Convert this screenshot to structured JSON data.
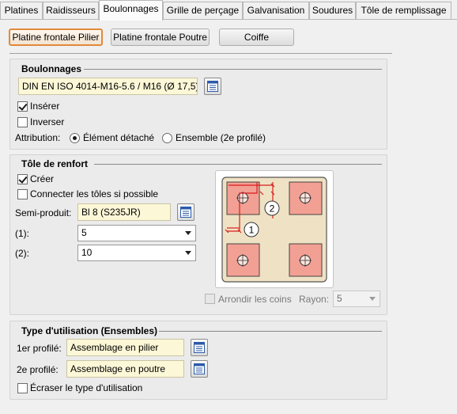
{
  "tabs": [
    "Platines",
    "Raidisseurs",
    "Boulonnages",
    "Grille de perçage",
    "Galvanisation",
    "Soudures",
    "Tôle de remplissage"
  ],
  "active_tab": "Boulonnages",
  "top_buttons": [
    "Platine frontale Pilier",
    "Platine frontale Poutre",
    "Coiffe"
  ],
  "bolting": {
    "title": "Boulonnages",
    "bolt_value": "DIN EN ISO 4014-M16-5.6 / M16 (Ø 17,5)",
    "insert_label": "Insérer",
    "insert_checked": true,
    "invert_label": "Inverser",
    "invert_checked": false,
    "attribution_label": "Attribution:",
    "attribution_options": [
      "Élément détaché",
      "Ensemble (2e profilé)"
    ],
    "attribution_selected": "Élément détaché"
  },
  "reinforcement": {
    "title": "Tôle de renfort",
    "create_label": "Créer",
    "create_checked": true,
    "connect_label": "Connecter les tôles si possible",
    "connect_checked": false,
    "semi_label": "Semi-produit:",
    "semi_value": "Bl 8  (S235JR)",
    "dim1_label": "(1):",
    "dim1_value": "5",
    "dim2_label": "(2):",
    "dim2_value": "10",
    "diagram_marker_1": "1",
    "diagram_marker_2": "2",
    "round_label": "Arrondir les coins",
    "round_checked": false,
    "radius_label": "Rayon:",
    "radius_value": "5"
  },
  "usage": {
    "title": "Type d'utilisation (Ensembles)",
    "profile1_label": "1er profilé:",
    "profile1_value": "Assemblage en pilier",
    "profile2_label": "2e profilé:",
    "profile2_value": "Assemblage en poutre",
    "overwrite_label": "Écraser le type d'utilisation",
    "overwrite_checked": false
  }
}
